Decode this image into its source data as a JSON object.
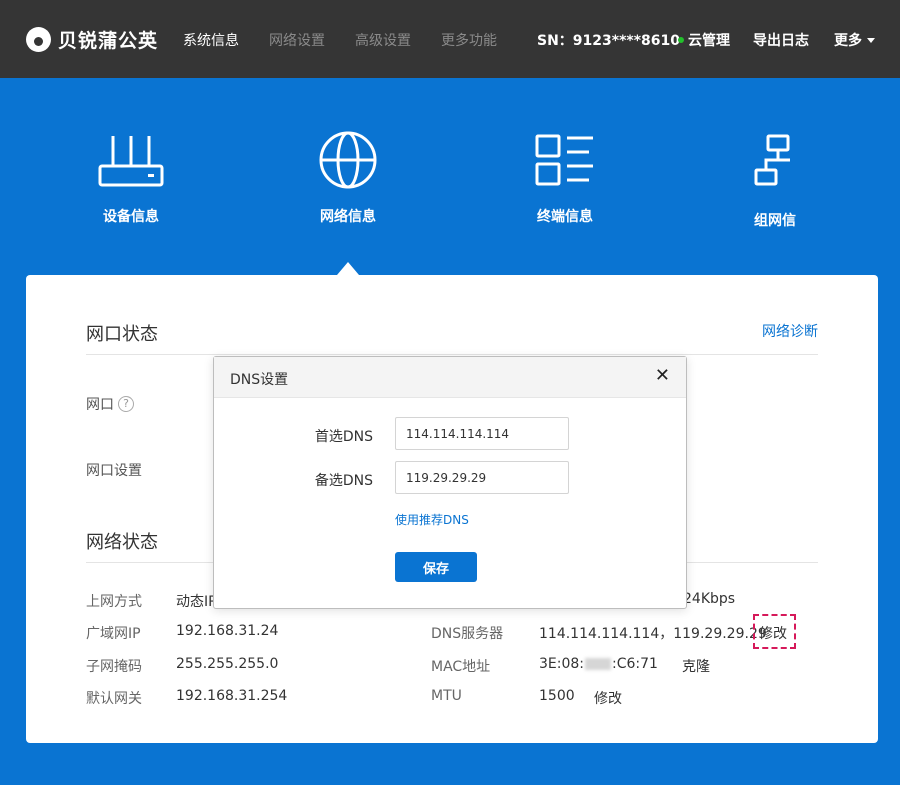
{
  "brand": {
    "name": "贝锐蒲公英"
  },
  "nav": [
    {
      "label": "系统信息",
      "active": true
    },
    {
      "label": "网络设置",
      "active": false
    },
    {
      "label": "高级设置",
      "active": false
    },
    {
      "label": "更多功能",
      "active": false
    }
  ],
  "header_right": {
    "sn": "SN：9123****8610",
    "cloud": "云管理",
    "export_log": "导出日志",
    "more": "更多"
  },
  "features": [
    {
      "label": "设备信息",
      "icon": "router-icon"
    },
    {
      "label": "网络信息",
      "icon": "globe-icon"
    },
    {
      "label": "终端信息",
      "icon": "list-grid-icon"
    },
    {
      "label": "组网信",
      "icon": "network-topology-icon"
    }
  ],
  "port_status": {
    "title": "网口状态",
    "diagnose_link": "网络诊断",
    "port_label": "网口",
    "help_symbol": "?",
    "port_settings_label": "网口设置"
  },
  "network_status": {
    "title": "网络状态",
    "left_rows": [
      {
        "label": "上网方式",
        "value": "动态IP"
      },
      {
        "label": "广域网IP",
        "value": "192.168.31.24"
      },
      {
        "label": "子网掩码",
        "value": "255.255.255.0"
      },
      {
        "label": "默认网关",
        "value": "192.168.31.254"
      }
    ],
    "speed_partial": "24Kbps",
    "dns_label": "DNS服务器",
    "dns_value": "114.114.114.114，119.29.29.29",
    "dns_edit": "修改",
    "mac_label": "MAC地址",
    "mac_prefix": "3E:08:",
    "mac_suffix": ":C6:71",
    "mac_clone": "克隆",
    "mtu_label": "MTU",
    "mtu_value": "1500",
    "mtu_edit": "修改"
  },
  "dns_dialog": {
    "title": "DNS设置",
    "close_symbol": "✕",
    "primary_label": "首选DNS",
    "primary_value": "114.114.114.114",
    "secondary_label": "备选DNS",
    "secondary_value": "119.29.29.29",
    "recommend_link": "使用推荐DNS",
    "save_label": "保存"
  },
  "colors": {
    "topbar": "#353535",
    "brand_blue": "#0a74d2",
    "online_dot": "#22c12b",
    "highlight_border": "#d6195a"
  }
}
